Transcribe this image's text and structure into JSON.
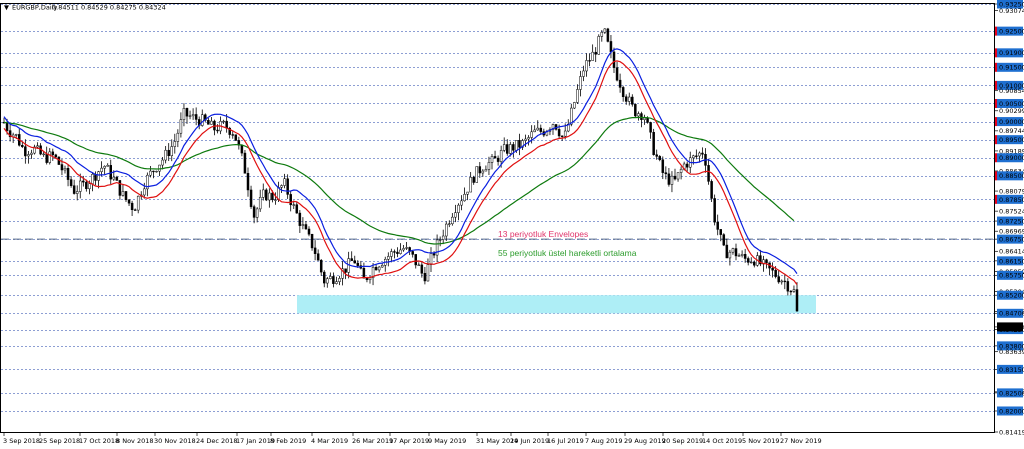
{
  "header": {
    "symbol": "EURGBP,Daily",
    "ohlc": "0.84511 0.84529 0.84275 0.84324"
  },
  "price_tag": "0.84324",
  "annotations": {
    "envelopes": "13 periyotluk Envelopes",
    "ema": "55 periyotluk üstel hareketli ortalama"
  },
  "colors": {
    "bullish_zone": "#aeeef6",
    "level_box": "#1e6fd0",
    "sr_box": "#e8001c",
    "envelope_upper": "#0a1fe0",
    "envelope_lower": "#e01010",
    "ema": "#0e7a0e",
    "grid": "#1c3fa8",
    "annotation_env": "#e0356b",
    "annotation_ema": "#2c9c2c"
  },
  "chart_data": {
    "type": "candlestick",
    "title": "EURGBP,Daily",
    "ylim": [
      0.81419,
      0.9325
    ],
    "right_axis_ticks": [
      "0.93250",
      "0.93074",
      "0.92500",
      "0.91900",
      "0.91500",
      "0.91000",
      "0.90854",
      "0.90500",
      "0.90299",
      "0.90000",
      "0.89744",
      "0.89500",
      "0.89189",
      "0.89000",
      "0.88634",
      "0.88500",
      "0.88079",
      "0.87850",
      "0.87524",
      "0.87250",
      "0.86969",
      "0.86750",
      "0.86414",
      "0.86150",
      "0.85859",
      "0.85750",
      "0.85304",
      "0.85200",
      "0.84749",
      "0.84700",
      "0.84324",
      "0.84250",
      "0.83800",
      "0.83639",
      "0.83150",
      "0.82529",
      "0.82500",
      "0.82000",
      "0.81419"
    ],
    "highlighted_levels": [
      "0.93250",
      "0.92500",
      "0.91900",
      "0.91500",
      "0.91000",
      "0.90500",
      "0.90000",
      "0.89500",
      "0.89000",
      "0.88500",
      "0.87850",
      "0.87250",
      "0.86750",
      "0.86150",
      "0.85750",
      "0.85200",
      "0.84700",
      "0.84250",
      "0.83800",
      "0.83150",
      "0.82500",
      "0.82000"
    ],
    "red_levels": [
      "0.92500",
      "0.91900",
      "0.91500",
      "0.91000",
      "0.90500",
      "0.90000",
      "0.89500",
      "0.89000",
      "0.88500",
      "0.87850"
    ],
    "x_labels": [
      "3 Sep 2018",
      "25 Sep 2018",
      "17 Oct 2018",
      "8 Nov 2018",
      "30 Nov 2018",
      "24 Dec 2018",
      "17 Jan 2019",
      "8 Feb 2019",
      "4 Mar 2019",
      "26 Mar 2019",
      "17 Apr 2019",
      "9 May 2019",
      "31 May 2019",
      "24 Jun 2019",
      "16 Jul 2019",
      "7 Aug 2019",
      "29 Aug 2019",
      "20 Sep 2019",
      "14 Oct 2019",
      "5 Nov 2019",
      "27 Nov 2019"
    ],
    "dashed_level": 0.8675,
    "zone": [
      0.847,
      0.852
    ],
    "path": [
      [
        0,
        0.8998
      ],
      [
        5,
        0.8975
      ],
      [
        12,
        0.896
      ],
      [
        20,
        0.892
      ],
      [
        30,
        0.8925
      ],
      [
        40,
        0.89
      ],
      [
        50,
        0.8905
      ],
      [
        60,
        0.886
      ],
      [
        70,
        0.881
      ],
      [
        80,
        0.8825
      ],
      [
        90,
        0.885
      ],
      [
        100,
        0.888
      ],
      [
        110,
        0.884
      ],
      [
        120,
        0.879
      ],
      [
        130,
        0.876
      ],
      [
        140,
        0.883
      ],
      [
        150,
        0.887
      ],
      [
        160,
        0.89
      ],
      [
        170,
        0.894
      ],
      [
        180,
        0.902
      ],
      [
        190,
        0.901
      ],
      [
        200,
        0.9
      ],
      [
        210,
        0.898
      ],
      [
        220,
        0.899
      ],
      [
        230,
        0.897
      ],
      [
        240,
        0.888
      ],
      [
        250,
        0.874
      ],
      [
        260,
        0.88
      ],
      [
        270,
        0.879
      ],
      [
        280,
        0.883
      ],
      [
        290,
        0.876
      ],
      [
        300,
        0.87
      ],
      [
        310,
        0.865
      ],
      [
        320,
        0.856
      ],
      [
        330,
        0.857
      ],
      [
        340,
        0.859
      ],
      [
        350,
        0.862
      ],
      [
        360,
        0.856
      ],
      [
        370,
        0.86
      ],
      [
        380,
        0.862
      ],
      [
        390,
        0.864
      ],
      [
        400,
        0.865
      ],
      [
        410,
        0.862
      ],
      [
        420,
        0.857
      ],
      [
        430,
        0.864
      ],
      [
        440,
        0.87
      ],
      [
        450,
        0.876
      ],
      [
        460,
        0.88
      ],
      [
        470,
        0.885
      ],
      [
        480,
        0.888
      ],
      [
        490,
        0.889
      ],
      [
        500,
        0.892
      ],
      [
        510,
        0.893
      ],
      [
        520,
        0.894
      ],
      [
        530,
        0.897
      ],
      [
        540,
        0.8975
      ],
      [
        550,
        0.9
      ],
      [
        560,
        0.895
      ],
      [
        570,
        0.905
      ],
      [
        580,
        0.915
      ],
      [
        590,
        0.919
      ],
      [
        600,
        0.925
      ],
      [
        610,
        0.915
      ],
      [
        620,
        0.908
      ],
      [
        630,
        0.903
      ],
      [
        640,
        0.902
      ],
      [
        650,
        0.892
      ],
      [
        660,
        0.885
      ],
      [
        670,
        0.883
      ],
      [
        680,
        0.888
      ],
      [
        690,
        0.89
      ],
      [
        700,
        0.892
      ],
      [
        710,
        0.874
      ],
      [
        720,
        0.864
      ],
      [
        730,
        0.864
      ],
      [
        740,
        0.862
      ],
      [
        750,
        0.862
      ],
      [
        760,
        0.86
      ],
      [
        770,
        0.858
      ],
      [
        780,
        0.856
      ],
      [
        790,
        0.853
      ],
      [
        795,
        0.8432
      ]
    ]
  }
}
